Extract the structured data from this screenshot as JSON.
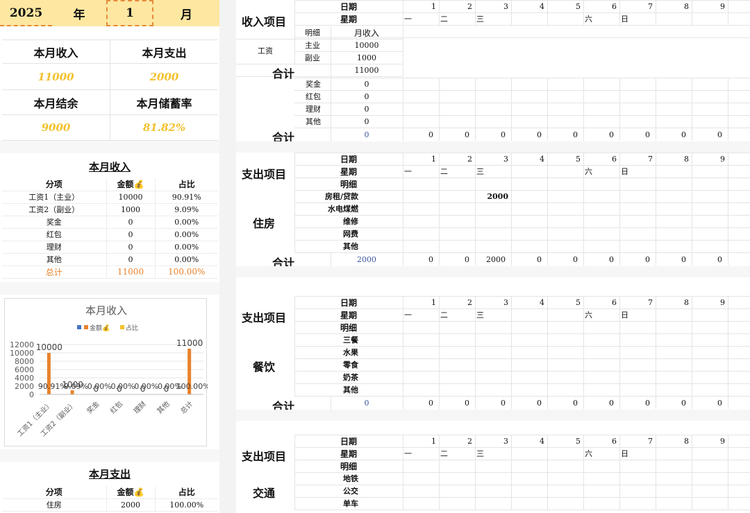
{
  "header": {
    "year": "2025",
    "year_label": "年",
    "month": "1",
    "month_label": "月"
  },
  "summary": {
    "income_label": "本月收入",
    "income_value": "11000",
    "expense_label": "本月支出",
    "expense_value": "2000",
    "balance_label": "本月结余",
    "balance_value": "9000",
    "saving_rate_label": "本月储蓄率",
    "saving_rate_value": "81.82%"
  },
  "income_table": {
    "title": "本月收入",
    "headers": [
      "分项",
      "金额💰",
      "占比"
    ],
    "rows": [
      [
        "工资1（主业）",
        "10000",
        "90.91%"
      ],
      [
        "工资2（副业）",
        "1000",
        "9.09%"
      ],
      [
        "奖金",
        "0",
        "0.00%"
      ],
      [
        "红包",
        "0",
        "0.00%"
      ],
      [
        "理财",
        "0",
        "0.00%"
      ],
      [
        "其他",
        "0",
        "0.00%"
      ]
    ],
    "total": [
      "总计",
      "11000",
      "100.00%"
    ]
  },
  "chart_data": {
    "type": "bar",
    "title": "本月收入",
    "categories": [
      "工资1（主业）",
      "工资2（副业）",
      "奖金",
      "红包",
      "理财",
      "其他",
      "总计"
    ],
    "series": [
      {
        "name": "金额💰",
        "values": [
          10000,
          1000,
          0,
          0,
          0,
          0,
          11000
        ],
        "labels": [
          "10000",
          "1000",
          "0",
          "0",
          "0",
          "0",
          "11000"
        ],
        "color": "#e8822c"
      },
      {
        "name": "占比",
        "values": [
          0.9091,
          0.0909,
          0,
          0,
          0,
          0,
          1
        ],
        "labels": [
          "90.91%",
          "9.09%",
          "0.00%",
          "0.00%",
          "0.00%",
          "0.00%",
          "100.00%"
        ],
        "color": "#f2c12e"
      }
    ],
    "legend_markers": [
      {
        "name": "",
        "color": "#4472c4"
      }
    ],
    "yticks": [
      "0",
      "2000",
      "4000",
      "6000",
      "8000",
      "10000",
      "12000"
    ],
    "ylim": [
      0,
      12000
    ],
    "legend": "top"
  },
  "expense_table": {
    "title": "本月支出",
    "headers": [
      "分项",
      "金额💰",
      "占比"
    ],
    "rows": [
      [
        "住房",
        "2000",
        "100.00%"
      ]
    ]
  },
  "grid": {
    "date_label": "日期",
    "weekday_label": "星期",
    "detail_label": "明细",
    "days": [
      "1",
      "2",
      "3",
      "4",
      "5",
      "6",
      "7",
      "8",
      "9"
    ],
    "weekdays": [
      "一",
      "二",
      "三",
      "",
      "",
      "六",
      "日",
      "",
      ""
    ],
    "total_label": "合计"
  },
  "income_section": {
    "title": "收入项目",
    "month_income_label": "月收入",
    "salary_label": "工资",
    "main_label": "主业",
    "main_value": "10000",
    "side_label": "副业",
    "side_value": "1000",
    "subtotal_value": "11000",
    "items": [
      {
        "name": "奖金",
        "value": "0"
      },
      {
        "name": "红包",
        "value": "0"
      },
      {
        "name": "理财",
        "value": "0"
      },
      {
        "name": "其他",
        "value": "0"
      }
    ],
    "total_value": "0",
    "daily_totals": [
      "0",
      "0",
      "0",
      "0",
      "0",
      "0",
      "0",
      "0",
      "0"
    ]
  },
  "housing_section": {
    "title": "支出项目",
    "category": "住房",
    "items": [
      "房租/贷款",
      "水电煤燃",
      "维修",
      "网费",
      "其他"
    ],
    "rent_day3": "2000",
    "total_value": "2000",
    "daily_totals": [
      "0",
      "0",
      "2000",
      "0",
      "0",
      "0",
      "0",
      "0",
      "0"
    ]
  },
  "food_section": {
    "title": "支出项目",
    "category": "餐饮",
    "items": [
      "三餐",
      "水果",
      "零食",
      "奶茶",
      "其他"
    ],
    "total_value": "0",
    "daily_totals": [
      "0",
      "0",
      "0",
      "0",
      "0",
      "0",
      "0",
      "0",
      "0"
    ]
  },
  "transport_section": {
    "title": "支出项目",
    "category": "交通",
    "items": [
      "地铁",
      "公交",
      "单车"
    ]
  }
}
